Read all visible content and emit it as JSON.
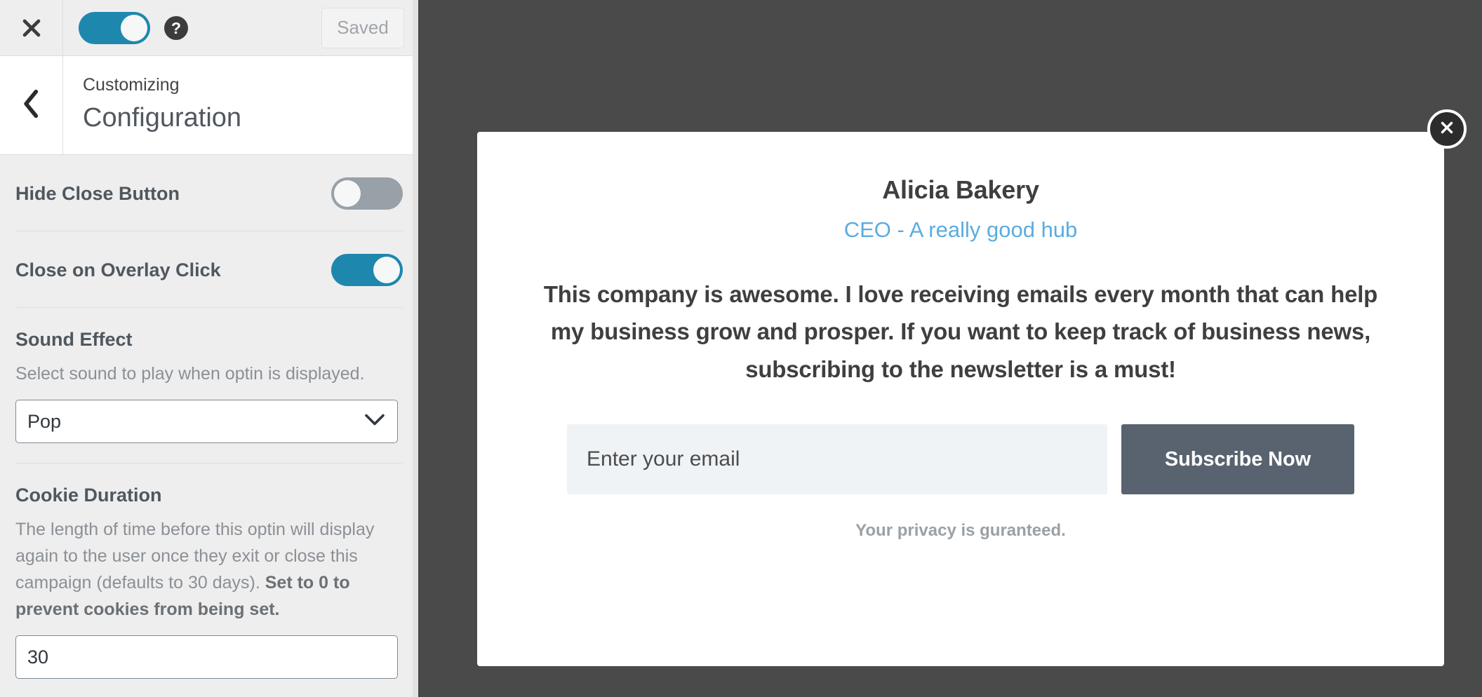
{
  "customizer": {
    "topbar": {
      "close_icon": "close-x-icon",
      "preview_toggle": {
        "state": "on",
        "label_icon": "toggle-switch"
      },
      "help_icon": "question-mark-icon",
      "save_button": "Saved"
    },
    "header": {
      "back_icon": "chevron-left-icon",
      "eyebrow": "Customizing",
      "title": "Configuration"
    },
    "controls": [
      {
        "type": "toggle",
        "name": "hide-close-button",
        "label": "Hide Close Button",
        "state": "off"
      },
      {
        "type": "toggle",
        "name": "close-on-overlay-click",
        "label": "Close on Overlay Click",
        "state": "on"
      },
      {
        "type": "select",
        "name": "sound-effect",
        "label": "Sound Effect",
        "description": "Select sound to play when optin is displayed.",
        "value": "Pop"
      },
      {
        "type": "number",
        "name": "cookie-duration",
        "label": "Cookie Duration",
        "description_normal": "The length of time before this optin will display again to the user once they exit or close this campaign (defaults to 30 days). ",
        "description_bold": "Set to 0 to prevent cookies from being set.",
        "value": "30"
      }
    ]
  },
  "preview": {
    "overlay_color": "#4a4a4a",
    "optin": {
      "close_icon": "close-circle-icon",
      "name": "Alicia Bakery",
      "role": "CEO - A really good hub",
      "quote": "This company is awesome. I love receiving emails every month that can help my business grow and prosper. If you want to keep track of business news, subscribing to the newsletter is a must!",
      "email_placeholder": "Enter your email",
      "email_value": "",
      "subscribe_label": "Subscribe Now",
      "privacy_note": "Your privacy is guranteed.",
      "accent_role_color": "#5bacdf",
      "button_color": "#59636f",
      "input_bg_color": "#eff3f6"
    }
  }
}
